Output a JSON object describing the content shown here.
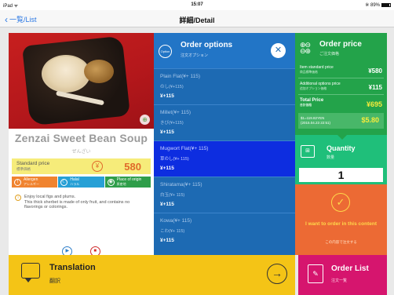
{
  "statusbar": {
    "carrier": "iPad ᯤ",
    "time": "15:07",
    "battery": "※ 89%"
  },
  "nav": {
    "back_label": "一覧/List",
    "title": "詳細/Detail"
  },
  "product": {
    "name": "Zenzai Sweet Bean Soup",
    "name_jp": "ぜんざい",
    "price_label": "Standard price",
    "price_label_jp": "標準価格",
    "price_icon": "¥",
    "price": "580",
    "tags": [
      {
        "label": "Allergen",
        "jp": "アレルギー",
        "icon": "allergen-icon"
      },
      {
        "label": "Halal",
        "jp": "ハラル",
        "icon": "halal-icon"
      },
      {
        "label": "Place of origin",
        "jp": "原産地",
        "icon": "origin-icon"
      }
    ],
    "description": "Enjoy local figs and plums.\nThis thick sherbet is made of only fruit, and contains no flavorings or colorings."
  },
  "options": {
    "badge": "Option",
    "title": "Order options",
    "subtitle": "注文オプション",
    "close": "✕",
    "items": [
      {
        "name": "Plain Flat(¥+ 115)",
        "name_jp": "のし(¥+115)",
        "price": "¥+115",
        "selected": false
      },
      {
        "name": "Millet(¥+ 115)",
        "name_jp": "きび(¥+115)",
        "price": "¥+115",
        "selected": false
      },
      {
        "name": "Mugwort Flat(¥+ 115)",
        "name_jp": "草のし(¥+ 115)",
        "price": "¥+115",
        "selected": true
      },
      {
        "name": "Shiratama(¥+ 115)",
        "name_jp": "白玉(¥+ 115)",
        "price": "¥+115",
        "selected": false
      },
      {
        "name": "Kowa(¥+ 115)",
        "name_jp": "こわ(¥+ 115)",
        "price": "¥+115",
        "selected": false
      }
    ]
  },
  "order_price": {
    "title": "Order price",
    "subtitle": "ご注文価格",
    "icon": "price-icon",
    "standard_label": "Item standard price",
    "standard_label_jp": "商品標準価格",
    "standard_value": "¥580",
    "additional_label": "Additional options price",
    "additional_label_jp": "追加オプション価格",
    "additional_value": "¥115",
    "total_label": "Total Price",
    "total_label_jp": "合計価格",
    "total_value": "¥695",
    "rate_line1": "$1=119.82YEN",
    "rate_line2": "(2015.04.23 22:51)",
    "usd_value": "$5.80"
  },
  "quantity": {
    "title": "Quantity",
    "subtitle": "数量",
    "value": "1"
  },
  "order_button": {
    "label": "I want to order in this content",
    "sublabel": "この内容で注文する",
    "icon": "check-icon"
  },
  "translation": {
    "title": "Translation",
    "subtitle": "翻訳",
    "arrow": "→"
  },
  "orderlist": {
    "title": "Order List",
    "subtitle": "注文一覧"
  },
  "colors": {
    "options_bg": "#1d6ab3",
    "selected_option": "#0d2de0",
    "order_price_bg": "#23a34a",
    "quantity_bg": "#1fbf7a",
    "order_button_bg": "#ec6a34",
    "translation_bg": "#f4c416",
    "orderlist_bg": "#d6156e"
  }
}
